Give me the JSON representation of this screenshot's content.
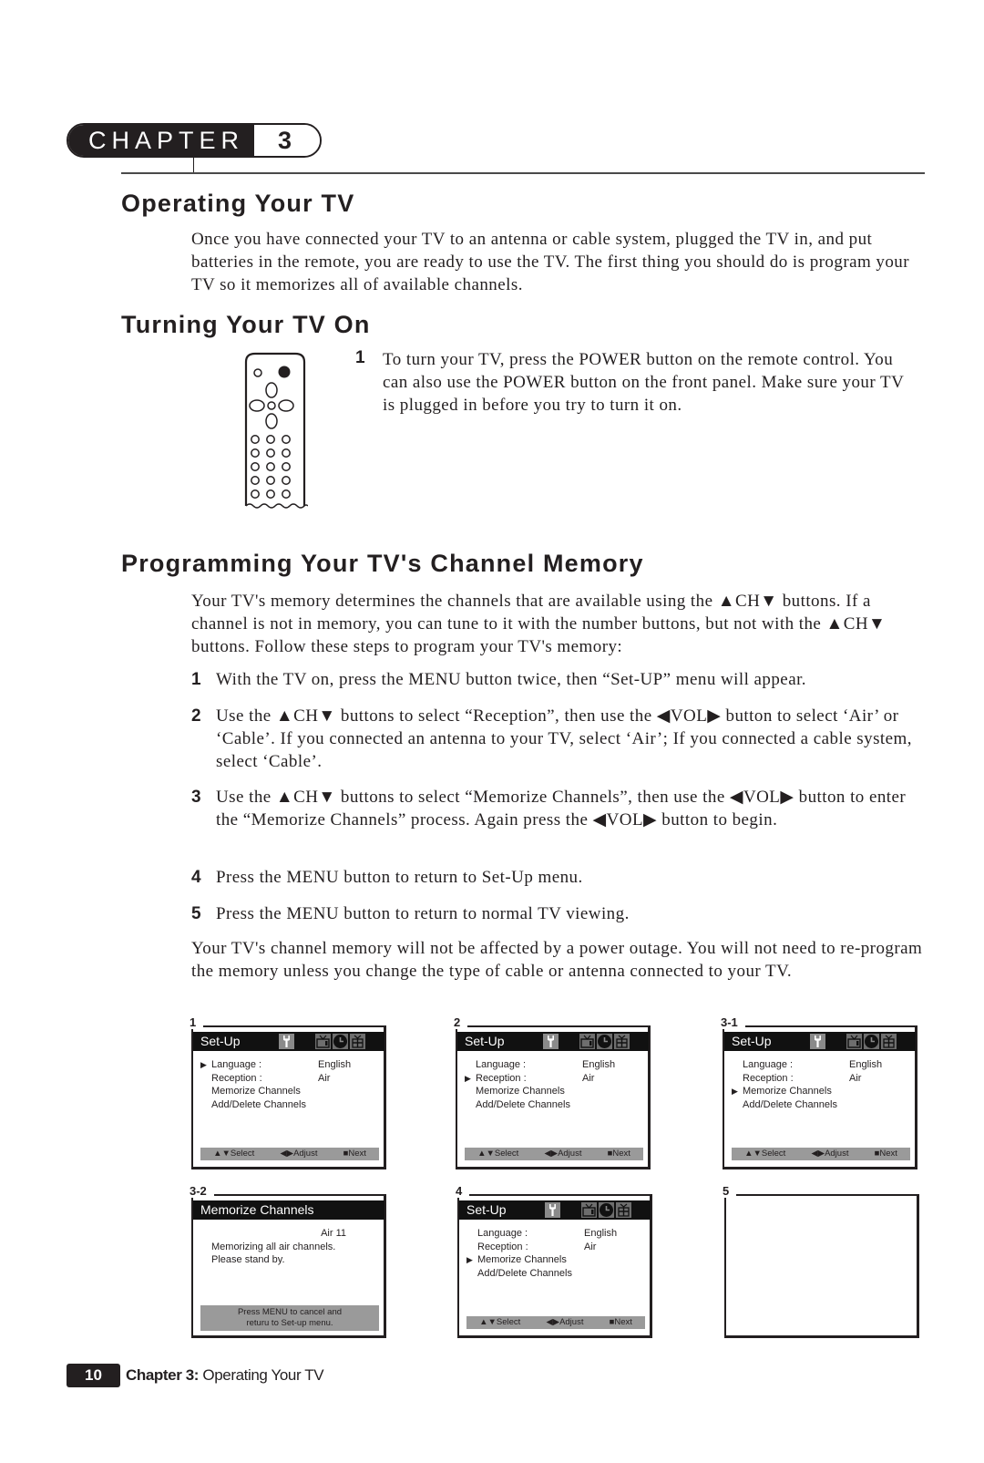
{
  "chapter": {
    "word": "CHAPTER",
    "number": "3"
  },
  "sections": {
    "operating": {
      "title": "Operating Your TV",
      "body": "Once you have connected your TV to an antenna or cable system, plugged the TV in, and put batteries in the remote, you are ready to use the TV. The first thing you should do is program your TV so it memorizes all of available channels."
    },
    "turning_on": {
      "title": "Turning Your TV On",
      "step_number": "1",
      "step_text": "To turn your TV, press the POWER button on the remote control. You can also use the POWER button on the front panel. Make sure your TV is plugged in before you try to turn it on.",
      "illustration": "remote-control"
    },
    "programming": {
      "title": "Programming Your TV's Channel Memory",
      "intro": "Your TV's memory determines the channels that are  available using the ▲CH▼ buttons. If a channel is not in memory, you can tune to it with the number buttons, but not with the ▲CH▼ buttons. Follow these steps to program your TV's memory:",
      "steps": [
        {
          "n": "1",
          "text": "With the TV on, press the MENU button twice, then “Set-UP” menu will appear."
        },
        {
          "n": "2",
          "text": "Use the ▲CH▼ buttons to select “Reception”, then use the ◀VOL▶ button to select ‘Air’ or ‘Cable’. If you connected an antenna to your TV, select ‘Air’; If you connected a cable system, select ‘Cable’."
        },
        {
          "n": "3",
          "text": "Use the ▲CH▼ buttons to select “Memorize Channels”, then use the ◀VOL▶ button to enter the “Memorize Channels” process. Again press the ◀VOL▶ button to begin."
        },
        {
          "n": "4",
          "text": "Press the MENU button to return to Set-Up menu."
        },
        {
          "n": "5",
          "text": "Press the MENU button to return to normal TV viewing."
        }
      ],
      "outro": "Your TV's channel memory will not be affected by a power outage. You will not need to re-program the memory unless you change the type of cable or antenna connected to your TV."
    }
  },
  "screens": {
    "menu_rows": [
      {
        "key": "Language :",
        "value": "English"
      },
      {
        "key": "Reception :",
        "value": "Air"
      },
      {
        "key": "Memorize Channels",
        "value": ""
      },
      {
        "key": "Add/Delete Channels",
        "value": ""
      }
    ],
    "setup_title": "Set-Up",
    "icons": [
      "wrench-icon",
      "tv-icon",
      "clock-icon",
      "gift-icon"
    ],
    "bar": {
      "select": "▲▼Select",
      "adjust": "◀▶Adjust",
      "next": "■Next"
    },
    "s1": {
      "label": "1",
      "selected_row": 0
    },
    "s2": {
      "label": "2",
      "selected_row": 1
    },
    "s31": {
      "label": "3-1",
      "selected_row": 2
    },
    "s32": {
      "label": "3-2",
      "title": "Memorize Channels",
      "channel": "Air 11",
      "line1": "Memorizing all air channels.",
      "line2": "Please stand by.",
      "note1": "Press MENU to cancel and",
      "note2": "returu to Set-up menu."
    },
    "s4": {
      "label": "4",
      "selected_row": 2
    },
    "s5": {
      "label": "5"
    }
  },
  "footer": {
    "page": "10",
    "chapter_label": "Chapter 3:",
    "chapter_title": " Operating Your TV"
  }
}
